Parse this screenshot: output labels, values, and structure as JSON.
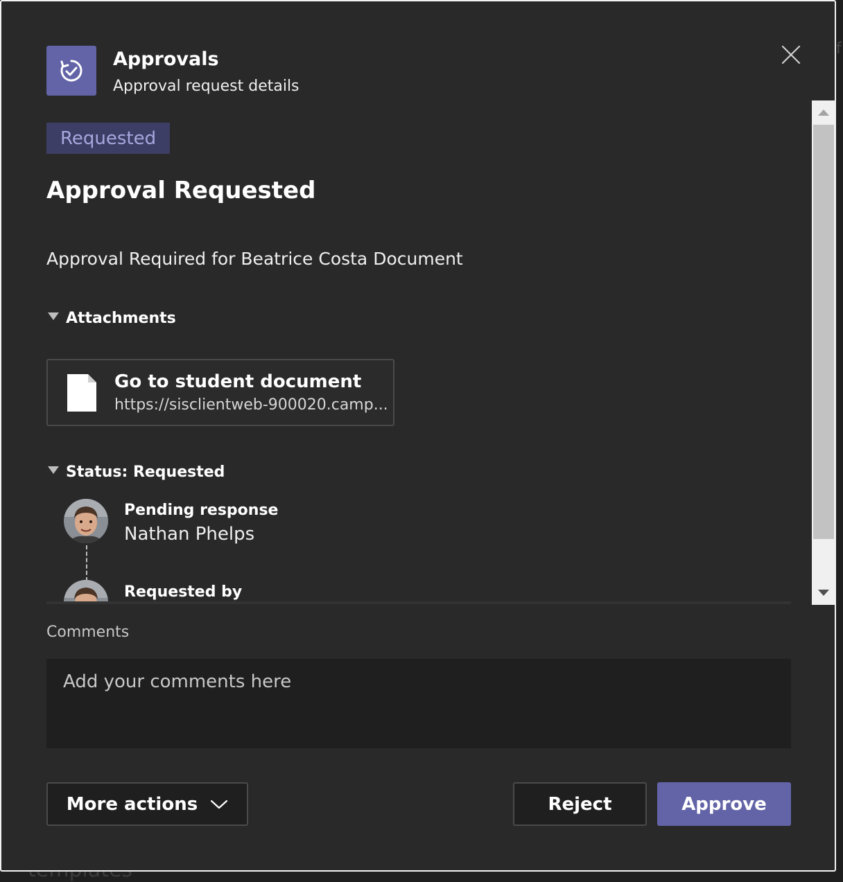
{
  "header": {
    "app_name": "Approvals",
    "subtitle": "Approval request details",
    "icon": "approvals-icon",
    "close_icon": "close-icon"
  },
  "card": {
    "status_badge": "Requested",
    "title": "Approval Requested",
    "description": "Approval Required for Beatrice Costa Document"
  },
  "attachments": {
    "heading": "Attachments",
    "items": [
      {
        "title": "Go to student document",
        "url": "https://sisclientweb-900020.camp...",
        "icon": "document-icon"
      }
    ]
  },
  "status": {
    "heading": "Status: Requested",
    "entries": [
      {
        "label": "Pending response",
        "name": "Nathan Phelps"
      },
      {
        "label": "Requested by",
        "name": ""
      }
    ]
  },
  "comments": {
    "label": "Comments",
    "placeholder": "Add your comments here",
    "value": ""
  },
  "actions": {
    "more_actions": "More actions",
    "reject": "Reject",
    "approve": "Approve"
  },
  "background": {
    "partial_text": "templates",
    "edge_char": "f"
  },
  "colors": {
    "accent": "#6264a7",
    "badge_bg": "#3d3e66",
    "badge_text": "#a6a7dc",
    "dialog_bg": "#292929",
    "input_bg": "#1f1f1f"
  }
}
